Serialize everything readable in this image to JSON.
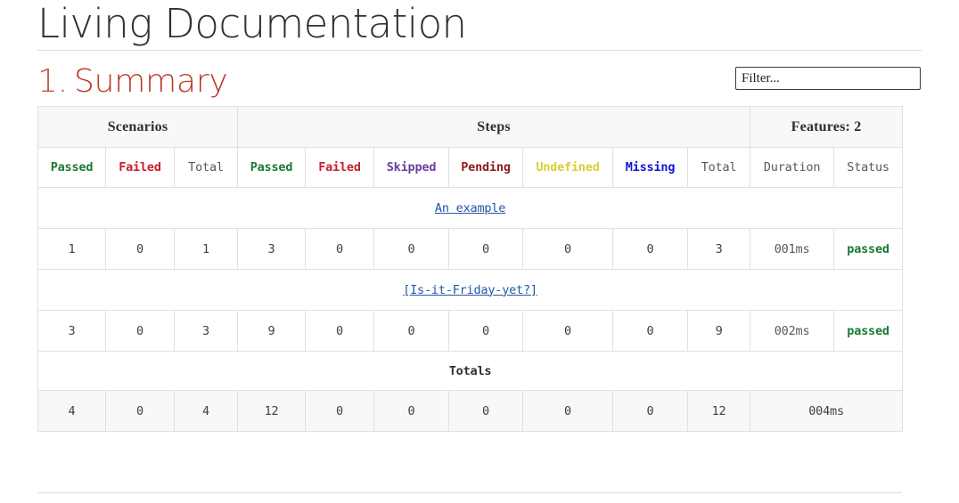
{
  "document": {
    "title": "Living Documentation"
  },
  "section": {
    "number": "1.",
    "title": "Summary"
  },
  "filter": {
    "placeholder": "Filter...",
    "value": ""
  },
  "table": {
    "group_headers": [
      {
        "label": "Scenarios",
        "colspan": 3
      },
      {
        "label": "Steps",
        "colspan": 7
      },
      {
        "label": "Features: 2",
        "colspan": 2
      }
    ],
    "columns": [
      {
        "label": "Passed",
        "style": "passed"
      },
      {
        "label": "Failed",
        "style": "failed"
      },
      {
        "label": "Total",
        "style": "total"
      },
      {
        "label": "Passed",
        "style": "passed"
      },
      {
        "label": "Failed",
        "style": "failed"
      },
      {
        "label": "Skipped",
        "style": "skipped"
      },
      {
        "label": "Pending",
        "style": "pending"
      },
      {
        "label": "Undefined",
        "style": "undefined"
      },
      {
        "label": "Missing",
        "style": "missing"
      },
      {
        "label": "Total",
        "style": "total"
      },
      {
        "label": "Duration",
        "style": "total"
      },
      {
        "label": "Status",
        "style": "total"
      }
    ],
    "features": [
      {
        "name": "An example",
        "scenarios_passed": "1",
        "scenarios_failed": "0",
        "scenarios_total": "1",
        "steps_passed": "3",
        "steps_failed": "0",
        "steps_skipped": "0",
        "steps_pending": "0",
        "steps_undefined": "0",
        "steps_missing": "0",
        "steps_total": "3",
        "duration": "001ms",
        "status": "passed"
      },
      {
        "name": "[Is-it-Friday-yet?]",
        "scenarios_passed": "3",
        "scenarios_failed": "0",
        "scenarios_total": "3",
        "steps_passed": "9",
        "steps_failed": "0",
        "steps_skipped": "0",
        "steps_pending": "0",
        "steps_undefined": "0",
        "steps_missing": "0",
        "steps_total": "9",
        "duration": "002ms",
        "status": "passed"
      }
    ],
    "totals": {
      "label": "Totals",
      "scenarios_passed": "4",
      "scenarios_failed": "0",
      "scenarios_total": "4",
      "steps_passed": "12",
      "steps_failed": "0",
      "steps_skipped": "0",
      "steps_pending": "0",
      "steps_undefined": "0",
      "steps_missing": "0",
      "steps_total": "12",
      "duration": "004ms"
    }
  },
  "colors": {
    "heading": "#ba3925",
    "passed": "#1a7a32",
    "failed": "#c7202a",
    "skipped": "#6b3fa0",
    "pending": "#8e1a1a",
    "undefined": "#d8d035",
    "missing": "#1414d8",
    "link": "#2156a5",
    "neutral": "#555a60"
  }
}
